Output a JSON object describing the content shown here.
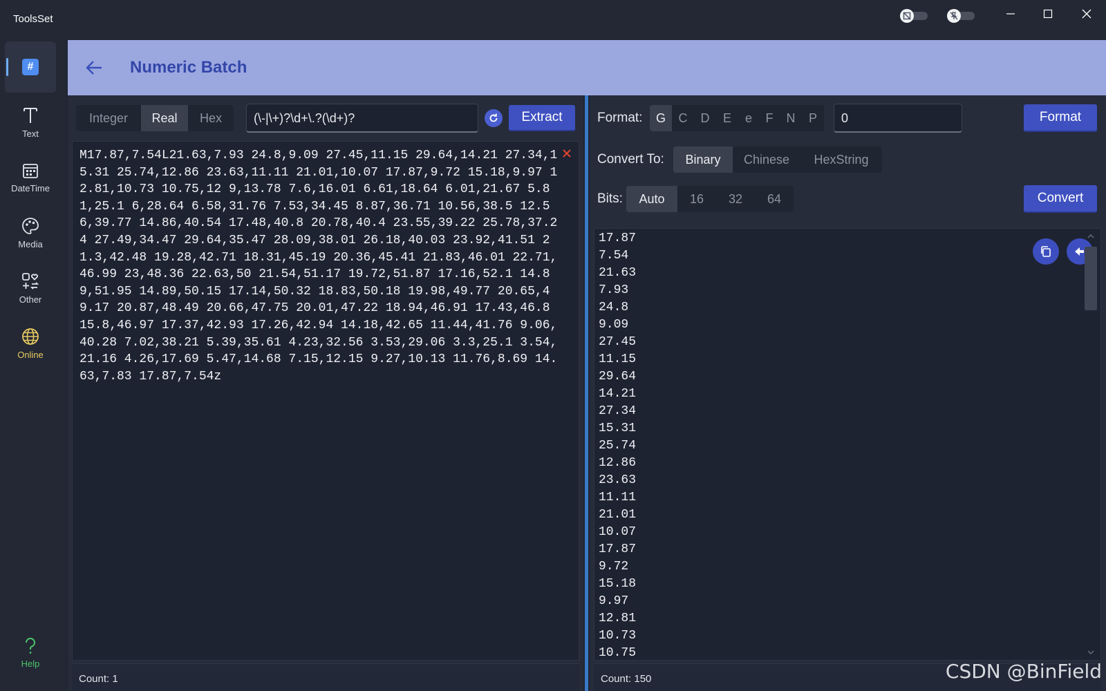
{
  "window": {
    "title": "ToolsSet",
    "minimize_icon": "minimize-icon",
    "maximize_icon": "maximize-icon",
    "close_icon": "close-icon"
  },
  "sidebar": {
    "items": [
      {
        "label": "",
        "icon": "hash-icon"
      },
      {
        "label": "Text",
        "icon": "text-icon"
      },
      {
        "label": "DateTime",
        "icon": "calendar-icon"
      },
      {
        "label": "Media",
        "icon": "palette-icon"
      },
      {
        "label": "Other",
        "icon": "other-icon"
      },
      {
        "label": "Online",
        "icon": "globe-icon"
      },
      {
        "label": "Help",
        "icon": "help-icon"
      }
    ]
  },
  "header": {
    "title": "Numeric Batch"
  },
  "left": {
    "modes": [
      "Integer",
      "Real",
      "Hex"
    ],
    "selected_mode": "Real",
    "regex": "(\\-|\\+)?\\d+\\.?(\\d+)?",
    "extract_label": "Extract",
    "input_text": "M17.87,7.54L21.63,7.93 24.8,9.09 27.45,11.15 29.64,14.21 27.34,15.31 25.74,12.86 23.63,11.11 21.01,10.07 17.87,9.72 15.18,9.97 12.81,10.73 10.75,12 9,13.78 7.6,16.01 6.61,18.64 6.01,21.67 5.81,25.1 6,28.64 6.58,31.76 7.53,34.45 8.87,36.71 10.56,38.5 12.56,39.77 14.86,40.54 17.48,40.8 20.78,40.4 23.55,39.22 25.78,37.24 27.49,34.47 29.64,35.47 28.09,38.01 26.18,40.03 23.92,41.51 21.3,42.48 19.28,42.71 18.31,45.19 20.36,45.41 21.83,46.01 22.71,46.99 23,48.36 22.63,50 21.54,51.17 19.72,51.87 17.16,52.1 14.89,51.95 14.89,50.15 17.14,50.32 18.83,50.18 19.98,49.77 20.65,49.17 20.87,48.49 20.66,47.75 20.01,47.22 18.94,46.91 17.43,46.8 15.8,46.97 17.37,42.93 17.26,42.94 14.18,42.65 11.44,41.76 9.06,40.28 7.02,38.21 5.39,35.61 4.23,32.56 3.53,29.06 3.3,25.1 3.54,21.16 4.26,17.69 5.47,14.68 7.15,12.15 9.27,10.13 11.76,8.69 14.63,7.83 17.87,7.54z",
    "count": "Count: 1"
  },
  "right": {
    "format_label": "Format:",
    "format_options": [
      "G",
      "C",
      "D",
      "E",
      "e",
      "F",
      "N",
      "P"
    ],
    "selected_format": "G",
    "format_value": "0",
    "format_button": "Format",
    "convert_to_label": "Convert To:",
    "convert_options": [
      "Binary",
      "Chinese",
      "HexString"
    ],
    "selected_convert": "Binary",
    "bits_label": "Bits:",
    "bits_options": [
      "Auto",
      "16",
      "32",
      "64"
    ],
    "selected_bits": "Auto",
    "convert_button": "Convert",
    "output": [
      "17.87",
      "7.54",
      "21.63",
      "7.93",
      "24.8",
      "9.09",
      "27.45",
      "11.15",
      "29.64",
      "14.21",
      "27.34",
      "15.31",
      "25.74",
      "12.86",
      "23.63",
      "11.11",
      "21.01",
      "10.07",
      "17.87",
      "9.72",
      "15.18",
      "9.97",
      "12.81",
      "10.73",
      "10.75"
    ],
    "count": "Count: 150"
  },
  "watermark": "CSDN @BinField",
  "colors": {
    "accent": "#3f51c0",
    "header_bg": "#9ba8e0",
    "title": "#3346a8",
    "divider": "#3a78c8",
    "online": "#e8c960",
    "help": "#4cc46a",
    "clear": "#e0452f"
  }
}
